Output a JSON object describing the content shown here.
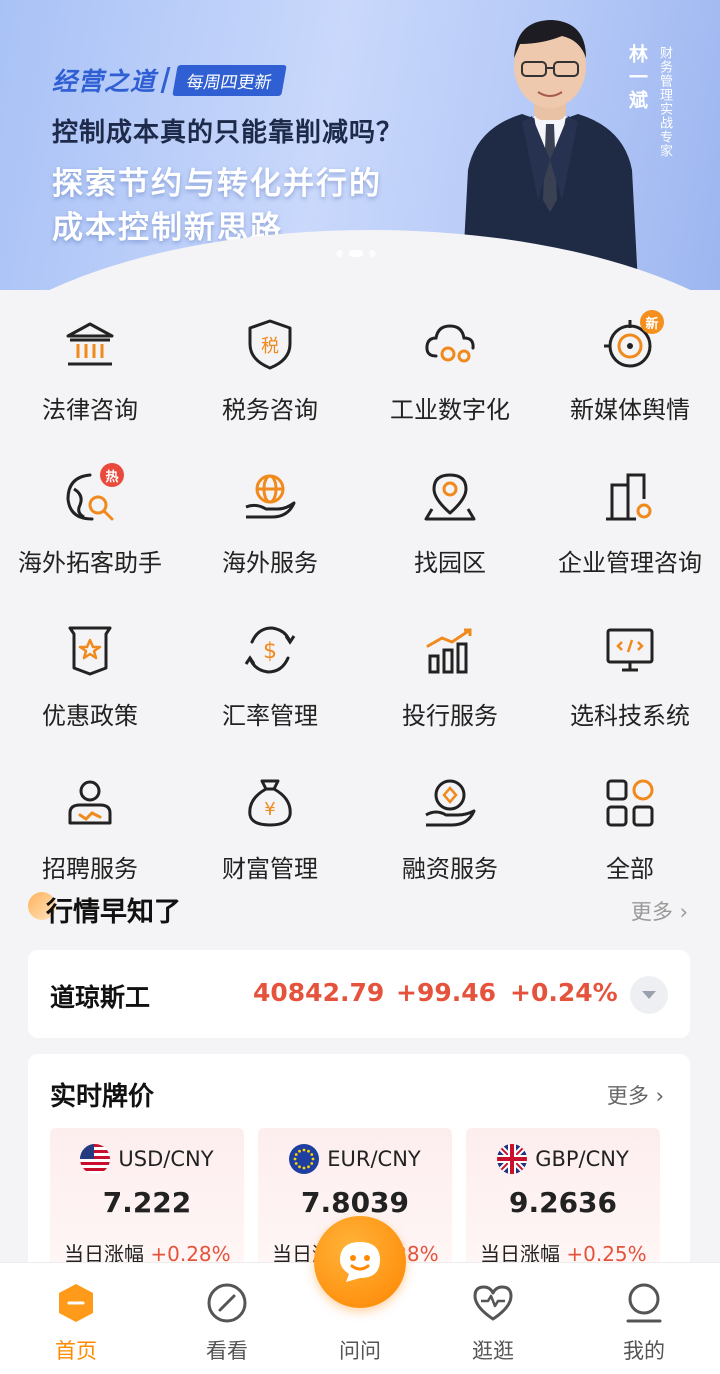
{
  "banner": {
    "brand": "经营之道",
    "tag": "每周四更新",
    "line1": "控制成本真的只能靠削减吗？",
    "line2": "探索节约与转化并行的",
    "line3": "成本控制新思路",
    "speaker_name": "林一斌",
    "speaker_title": "财务管理实战专家",
    "active_slide": 2,
    "slide_count": 3
  },
  "services": [
    {
      "label": "法律咨询",
      "icon": "courthouse-icon"
    },
    {
      "label": "税务咨询",
      "icon": "tax-shield-icon",
      "icon_text": "税"
    },
    {
      "label": "工业数字化",
      "icon": "cloud-gears-icon"
    },
    {
      "label": "新媒体舆情",
      "icon": "target-icon",
      "badge": "新"
    },
    {
      "label": "海外拓客助手",
      "icon": "globe-search-icon",
      "badge": "热"
    },
    {
      "label": "海外服务",
      "icon": "globe-hand-icon"
    },
    {
      "label": "找园区",
      "icon": "location-pin-icon"
    },
    {
      "label": "企业管理咨询",
      "icon": "building-gear-icon"
    },
    {
      "label": "优惠政策",
      "icon": "star-document-icon"
    },
    {
      "label": "汇率管理",
      "icon": "dollar-exchange-icon"
    },
    {
      "label": "投行服务",
      "icon": "bar-chart-trend-icon"
    },
    {
      "label": "选科技系统",
      "icon": "monitor-code-icon"
    },
    {
      "label": "招聘服务",
      "icon": "person-card-icon"
    },
    {
      "label": "财富管理",
      "icon": "money-bag-icon",
      "icon_text": "¥"
    },
    {
      "label": "融资服务",
      "icon": "hand-coin-icon"
    },
    {
      "label": "全部",
      "icon": "all-grid-icon"
    }
  ],
  "market": {
    "title": "行情早知了",
    "more": "更多 ›",
    "index": {
      "name": "道琼斯工",
      "value": "40842.79",
      "change": "+99.46",
      "percent": "+0.24%"
    }
  },
  "rates": {
    "title": "实时牌价",
    "more": "更多 ›",
    "daily_label": "当日涨幅",
    "items": [
      {
        "pair": "USD/CNY",
        "price": "7.222",
        "change": "+0.28%",
        "flag": "us-flag-icon"
      },
      {
        "pair": "EUR/CNY",
        "price": "7.8039",
        "change": "+0.28%",
        "flag": "eu-flag-icon"
      },
      {
        "pair": "GBP/CNY",
        "price": "9.2636",
        "change": "+0.25%",
        "flag": "uk-flag-icon"
      }
    ]
  },
  "tabs": [
    {
      "label": "首页",
      "icon": "home-hexagon-icon",
      "active": true
    },
    {
      "label": "看看",
      "icon": "compass-icon"
    },
    {
      "label": "问问",
      "icon": "chat-bubble-icon"
    },
    {
      "label": "逛逛",
      "icon": "heart-pulse-icon"
    },
    {
      "label": "我的",
      "icon": "user-icon"
    }
  ],
  "colors": {
    "accent": "#ff8a00",
    "up": "#e5533d",
    "banner_blue": "#2f5fd3"
  }
}
